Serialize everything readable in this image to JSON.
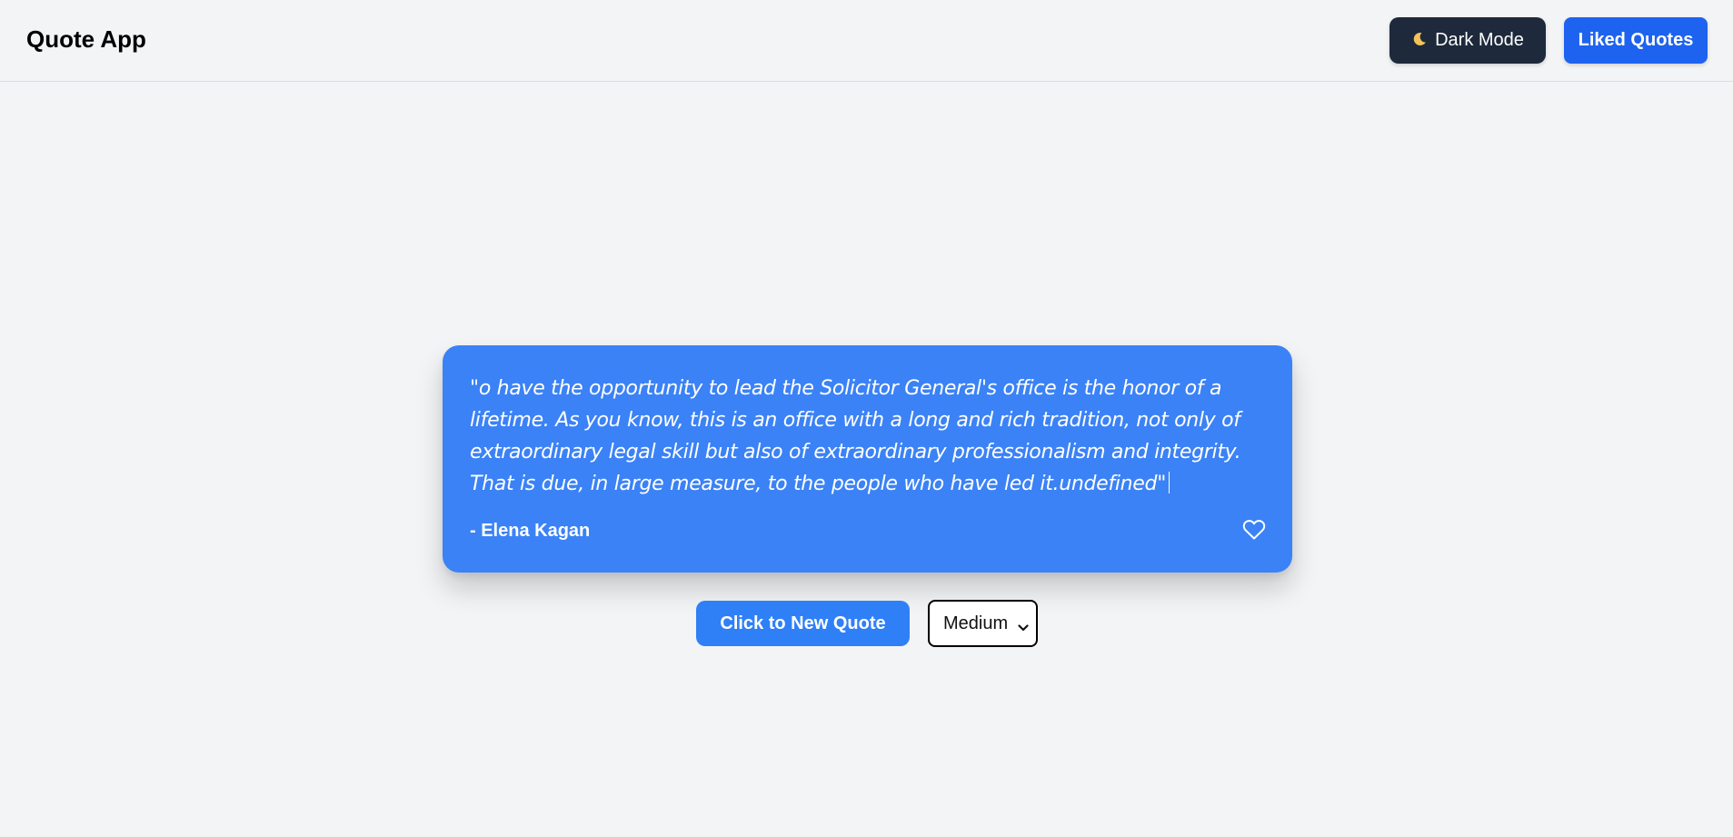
{
  "header": {
    "app_title": "Quote App",
    "dark_mode_label": "Dark Mode",
    "dark_mode_icon": "moon-icon",
    "liked_quotes_label": "Liked Quotes"
  },
  "quote": {
    "text": "\"o have the opportunity to lead the Solicitor General's office is the honor of a lifetime. As you know, this is an office with a long and rich tradition, not only of extraordinary legal skill but also of extraordinary professionalism and integrity. That is due, in large measure, to the people who have led it.undefined\"",
    "author": "- Elena Kagan",
    "like_icon": "heart-outline-icon"
  },
  "controls": {
    "new_quote_label": "Click to New Quote",
    "speed_selected": "Medium"
  },
  "colors": {
    "background": "#f3f4f6",
    "card": "#3b82f6",
    "dark_button": "#1e293b",
    "liked_button": "#1d63f0",
    "new_quote_button": "#2f80f7"
  }
}
